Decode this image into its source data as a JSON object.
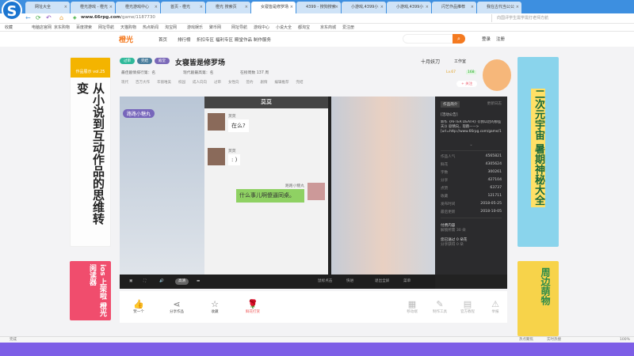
{
  "browser": {
    "tabs": [
      "网址大全",
      "橙光游戏 - 橙光",
      "橙光游戏中心",
      "首页 - 橙光",
      "橙光 搜索页",
      "女寝皆是修罗场",
      "4399 - 搜狗搜索",
      "小游戏,4399小",
      "小游戏,4399小",
      "闪艺作品推荐",
      "我在古代当公公"
    ],
    "url_host": "www.66rpg.com",
    "url_path": "/game/1187730",
    "search_placeholder": "向国评学生需学需打老师方航",
    "bookmarks": [
      "收藏",
      "电脑店官网",
      "京东购物",
      "百度搜索",
      "网址导航",
      "天猫购物",
      "热点新闻",
      "淘宝网",
      "游戏娱乐",
      "聚币网",
      "网址导航",
      "游戏中心",
      "小说大全",
      "都淘宝",
      "京东商城",
      "爱注册"
    ]
  },
  "site": {
    "logo": "橙光",
    "nav": [
      "首页",
      "排行榜",
      "折扣专区",
      "福利专区",
      "殿堂作品",
      "制作服务"
    ],
    "login": "登录",
    "register": "注册"
  },
  "game": {
    "tags": [
      {
        "label": "过审",
        "color": "#2fb99a"
      },
      {
        "label": "完结",
        "color": "#4a7d9c"
      },
      {
        "label": "殿堂",
        "color": "#7a68b8"
      }
    ],
    "title": "女寝皆是修罗场",
    "rank1": "最佳剧情排行第：名",
    "rank2": "现代剧最高第：名",
    "weeks": "在榜周数 137 周",
    "genres": [
      "现代",
      "百万大作",
      "华丽唯美",
      "校园",
      "成人向向",
      "过审",
      "女性向",
      "签约",
      "剧情",
      "编辑推荐",
      "完结"
    ],
    "author": "十月妖刀",
    "studio": "工作室",
    "level": "Lv.67",
    "flowers": "168",
    "follow": "+ 关注"
  },
  "chat": {
    "header": "莫莫",
    "messages": [
      {
        "name": "莫莫",
        "text": "在么?"
      },
      {
        "name": "莫莫",
        "text": ": )"
      },
      {
        "name": "路路小糖丸",
        "text": "什么事儿啊傻逼同桌。"
      }
    ]
  },
  "scene": {
    "name_label": "路路小糖丸"
  },
  "panel": {
    "tab_intro": "作品简介",
    "tab_log": "更新日志",
    "notice_title": "[活动公告]",
    "notice": "新作《AFTER DEATH》《(我以后的那些天)》剧情向，现跳——> [url=http://www.66rpg.com/game/1570051]",
    "stats": [
      {
        "label": "作品人气",
        "value": "4565821"
      },
      {
        "label": "鲜花",
        "value": "4305624"
      },
      {
        "label": "字数",
        "value": "300261"
      },
      {
        "label": "分享",
        "value": "427104"
      },
      {
        "label": "点赞",
        "value": "63737"
      },
      {
        "label": "收藏",
        "value": "121711"
      },
      {
        "label": "发布时间",
        "value": "2018-05-25"
      },
      {
        "label": "最后更新",
        "value": "2018-10-05"
      }
    ],
    "paid_title": "付费内容",
    "paid_sub": "解锁所需 30 朵",
    "flower_title": "您已送过 0 朵花",
    "flower_sub": "分享获得 0 朵"
  },
  "toolbar": {
    "quality": "高清",
    "controls": [
      "鼠标点击",
      "快进",
      "退出全屏",
      "菜单"
    ]
  },
  "actions": [
    "赞一个",
    "分享作品",
    "收藏",
    "鲜花打赏"
  ],
  "actions_right": [
    "移动端",
    "制作工具",
    "官方教程",
    "举报"
  ],
  "ads": {
    "left_top": "作品展示 vol.25",
    "left_text": "从小说到互动作品的思维转变",
    "left_bottom": "ios 上架啦 橙光阅读器",
    "right_text": "二次元宇宙 暑期神秘大全",
    "right_bottom": "周边萌物"
  },
  "status": {
    "left": "完成",
    "zoom": "100%",
    "items": [
      "热点聚焦",
      "实时热搜"
    ]
  }
}
